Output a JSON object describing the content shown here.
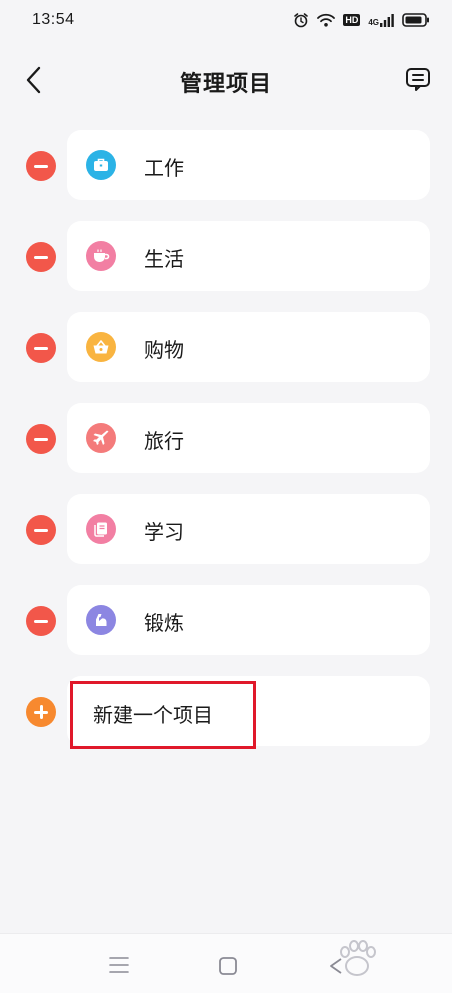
{
  "status_bar": {
    "time": "13:54",
    "icons": [
      "alarm-icon",
      "wifi-icon",
      "hd-badge",
      "signal-4g-icon",
      "battery-icon"
    ],
    "hd_label": "HD",
    "network_label": "4G"
  },
  "header": {
    "title": "管理项目",
    "back_icon": "chevron-left-icon",
    "action_icon": "feedback-icon"
  },
  "projects": [
    {
      "label": "工作",
      "icon": "briefcase-icon",
      "color": "#2bb3e6"
    },
    {
      "label": "生活",
      "icon": "cup-icon",
      "color": "#f27fa3"
    },
    {
      "label": "购物",
      "icon": "basket-icon",
      "color": "#f9b440"
    },
    {
      "label": "旅行",
      "icon": "airplane-icon",
      "color": "#f47b7b"
    },
    {
      "label": "学习",
      "icon": "book-icon",
      "color": "#f27fa3"
    },
    {
      "label": "锻炼",
      "icon": "muscle-icon",
      "color": "#8c86e2"
    }
  ],
  "new_project": {
    "label": "新建一个项目",
    "icon": "plus-icon"
  },
  "colors": {
    "remove": "#f2574a",
    "add": "#f7892f",
    "highlight": "#e0182a",
    "background": "#f5f5f7"
  },
  "nav_bar": {
    "icons": [
      "menu-icon",
      "home-icon",
      "back-icon"
    ]
  }
}
